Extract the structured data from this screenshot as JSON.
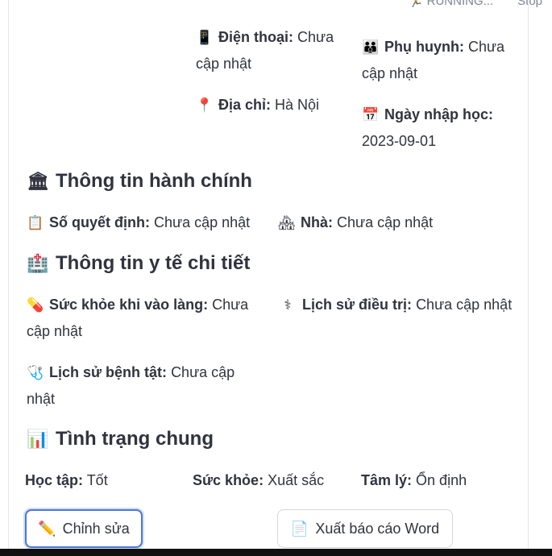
{
  "status": {
    "running": "RUNNING...",
    "stop": "Stop"
  },
  "contact": {
    "phone_label": "Điện thoại:",
    "phone_value": "Chưa cập nhật",
    "parent_label": "Phụ huynh:",
    "parent_value": "Chưa cập nhật",
    "address_label": "Địa chỉ:",
    "address_value": "Hà Nội",
    "enroll_label": "Ngày nhập học:",
    "enroll_value": "2023-09-01"
  },
  "admin": {
    "title": "Thông tin hành chính",
    "decision_label": "Số quyết định:",
    "decision_value": "Chưa cập nhật",
    "house_label": "Nhà:",
    "house_value": "Chưa cập nhật"
  },
  "medical": {
    "title": "Thông tin y tế chi tiết",
    "health_label": "Sức khỏe khi vào làng:",
    "health_value": "Chưa cập nhật",
    "treatment_label": "Lịch sử điều trị:",
    "treatment_value": "Chưa cập nhật",
    "disease_label": "Lịch sử bệnh tật:",
    "disease_value": "Chưa cập nhật"
  },
  "general": {
    "title": "Tình trạng chung",
    "study_label": "Học tập:",
    "study_value": "Tốt",
    "health_label": "Sức khỏe:",
    "health_value": "Xuất sắc",
    "psych_label": "Tâm lý:",
    "psych_value": "Ổn định"
  },
  "buttons": {
    "edit": "Chỉnh sửa",
    "export": "Xuất báo cáo Word"
  },
  "icons": {
    "phone": "phone-icon",
    "parent": "family-icon",
    "address": "pin-icon",
    "calendar": "calendar-icon",
    "admin": "building-icon",
    "decision": "clipboard-icon",
    "house": "house-icon",
    "medical": "hospital-icon",
    "pill": "pill-icon",
    "caduceus": "caduceus-icon",
    "stethoscope": "stethoscope-icon",
    "chart": "chart-icon",
    "pencil": "pencil-icon",
    "doc": "document-icon",
    "running": "running-icon"
  }
}
